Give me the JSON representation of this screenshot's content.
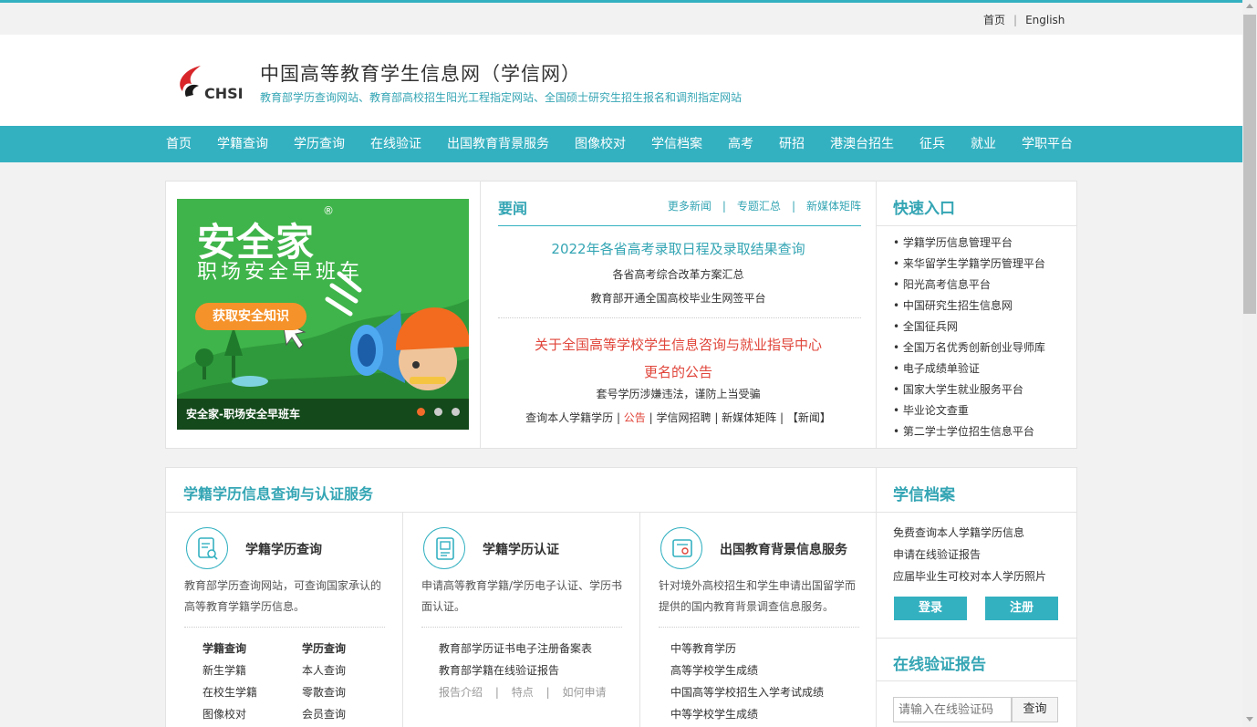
{
  "topbar": {
    "home": "首页",
    "sep": "|",
    "english": "English"
  },
  "header": {
    "title": "中国高等教育学生信息网（学信网）",
    "subtitle": "教育部学历查询网站、教育部高校招生阳光工程指定网站、全国硕士研究生招生报名和调剂指定网站",
    "logo_text": "CHSI"
  },
  "nav": [
    "首页",
    "学籍查询",
    "学历查询",
    "在线验证",
    "出国教育背景服务",
    "图像校对",
    "学信档案",
    "高考",
    "研招",
    "港澳台招生",
    "征兵",
    "就业",
    "学职平台"
  ],
  "banner": {
    "title": "安全家",
    "subtitle": "职场安全早班车",
    "button": "获取安全知识",
    "caption": "安全家-职场安全早班车",
    "reg": "®"
  },
  "news": {
    "title": "要闻",
    "more": [
      "更多新闻",
      "专题汇总",
      "新媒体矩阵"
    ],
    "sep": "|",
    "headline1": "2022年各省高考录取日程及录取结果查询",
    "item1": "各省高考综合改革方案汇总",
    "item2": "教育部开通全国高校毕业生网签平台",
    "headline2a": "关于全国高等学校学生信息咨询与就业指导中心",
    "headline2b": "更名的公告",
    "item3": "套号学历涉嫌违法，谨防上当受骗",
    "links": {
      "a": "查询本人学籍学历",
      "b": "公告",
      "c": "学信网招聘",
      "d": "新媒体矩阵",
      "e": "【新闻】",
      "sep": " | "
    }
  },
  "quick": {
    "title": "快速入口",
    "items": [
      "学籍学历信息管理平台",
      "来华留学生学籍学历管理平台",
      "阳光高考信息平台",
      "中国研究生招生信息网",
      "全国征兵网",
      "全国万名优秀创新创业导师库",
      "电子成绩单验证",
      "国家大学生就业服务平台",
      "毕业论文查重",
      "第二学士学位招生信息平台"
    ]
  },
  "services": {
    "title": "学籍学历信息查询与认证服务",
    "col1": {
      "heading": "学籍学历查询",
      "desc": "教育部学历查询网站，可查询国家承认的高等教育学籍学历信息。",
      "left": [
        "学籍查询",
        "新生学籍",
        "在校生学籍",
        "图像校对"
      ],
      "right": [
        "学历查询",
        "本人查询",
        "零散查询",
        "会员查询"
      ]
    },
    "col2": {
      "heading": "学籍学历认证",
      "desc": "申请高等教育学籍/学历电子认证、学历书面认证。",
      "links": [
        "教育部学历证书电子注册备案表",
        "教育部学籍在线验证报告"
      ],
      "sub": [
        "报告介绍",
        "特点",
        "如何申请"
      ],
      "sep": "|"
    },
    "col3": {
      "heading": "出国教育背景信息服务",
      "desc": "针对境外高校招生和学生申请出国留学而提供的国内教育背景调查信息服务。",
      "links": [
        "中等教育学历",
        "高等学校学生成绩",
        "中国高等学校招生入学考试成绩",
        "中等学校学生成绩"
      ]
    }
  },
  "archive": {
    "title": "学信档案",
    "items": [
      "免费查询本人学籍学历信息",
      "申请在线验证报告",
      "应届毕业生可校对本人学历照片"
    ],
    "login": "登录",
    "register": "注册"
  },
  "verify": {
    "title": "在线验证报告",
    "placeholder": "请输入在线验证码",
    "button": "查询"
  },
  "colors": {
    "accent": "#34b1c1",
    "red": "#e0453a",
    "orange": "#f5922a",
    "banner_green": "#3fb44a"
  }
}
